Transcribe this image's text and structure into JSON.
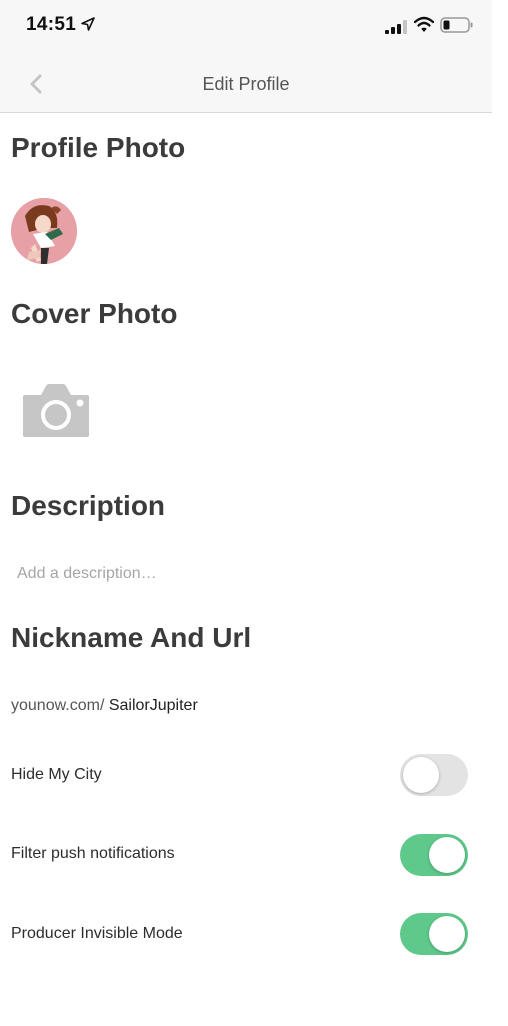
{
  "status_bar": {
    "time": "14:51"
  },
  "nav": {
    "title": "Edit Profile"
  },
  "sections": {
    "profile_photo": "Profile Photo",
    "cover_photo": "Cover Photo",
    "description": "Description",
    "nickname_url": "Nickname And Url"
  },
  "description": {
    "placeholder": "Add a description…",
    "value": ""
  },
  "url": {
    "prefix": "younow.com/",
    "nickname": "SailorJupiter"
  },
  "settings": [
    {
      "label": "Hide My City",
      "enabled": false
    },
    {
      "label": "Filter push notifications",
      "enabled": true
    },
    {
      "label": "Producer Invisible Mode",
      "enabled": true
    }
  ],
  "colors": {
    "toggle_on": "#5ec98b",
    "toggle_off": "#e3e3e3",
    "header_bg": "#f7f7f7"
  },
  "icons": [
    "location-arrow-icon",
    "signal-icon",
    "wifi-icon",
    "battery-icon",
    "back-chevron-icon",
    "camera-icon"
  ]
}
